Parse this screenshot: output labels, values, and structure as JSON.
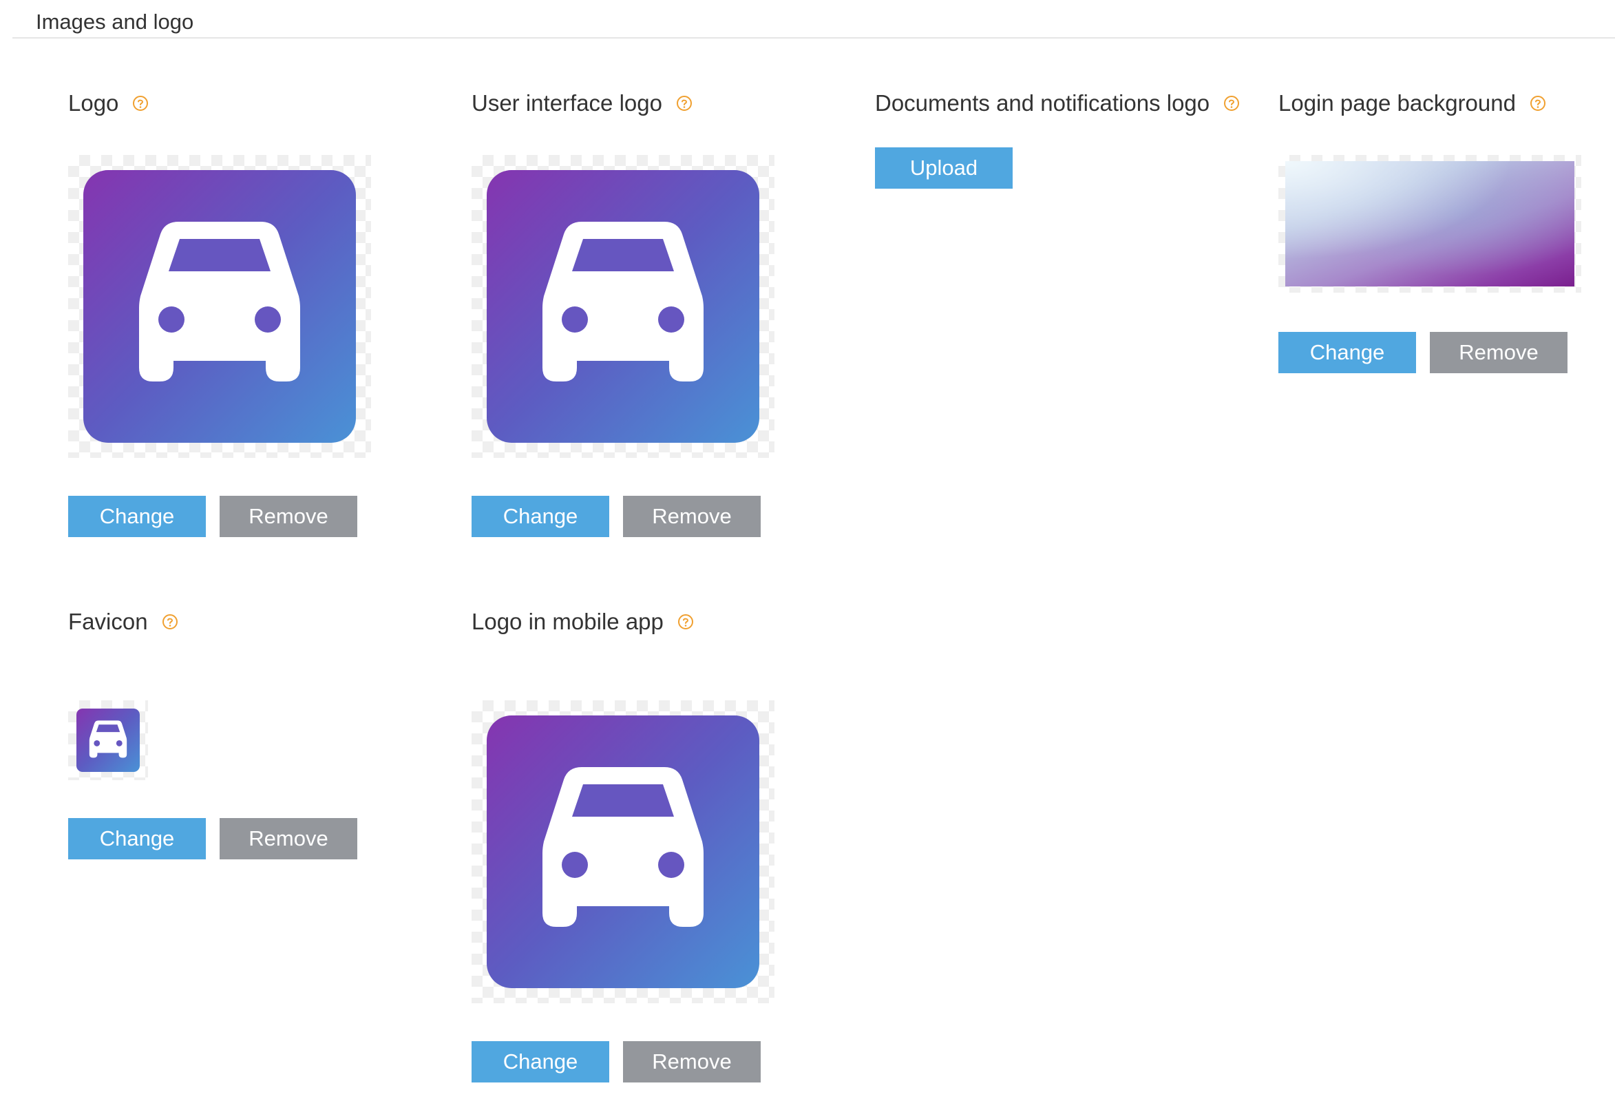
{
  "section": {
    "title": "Images and logo"
  },
  "colors": {
    "accent": "#50a7e0",
    "secondary_button": "#94979c",
    "help_icon": "#f0a030",
    "icon_gradient_start": "#8535b0",
    "icon_gradient_end": "#4a92d6"
  },
  "fields": {
    "logo": {
      "title": "Logo",
      "help_icon": "help-circle-icon",
      "preview_icon": "car-icon",
      "change_label": "Change",
      "remove_label": "Remove"
    },
    "ui_logo": {
      "title": "User interface logo",
      "help_icon": "help-circle-icon",
      "preview_icon": "car-icon",
      "change_label": "Change",
      "remove_label": "Remove"
    },
    "docs_logo": {
      "title": "Documents and notifications logo",
      "help_icon": "help-circle-icon",
      "upload_label": "Upload"
    },
    "login_bg": {
      "title": "Login page background",
      "help_icon": "help-circle-icon",
      "change_label": "Change",
      "remove_label": "Remove"
    },
    "favicon": {
      "title": "Favicon",
      "help_icon": "help-circle-icon",
      "preview_icon": "car-icon",
      "change_label": "Change",
      "remove_label": "Remove"
    },
    "mobile_logo": {
      "title": "Logo in mobile app",
      "help_icon": "help-circle-icon",
      "preview_icon": "car-icon",
      "change_label": "Change",
      "remove_label": "Remove"
    }
  }
}
